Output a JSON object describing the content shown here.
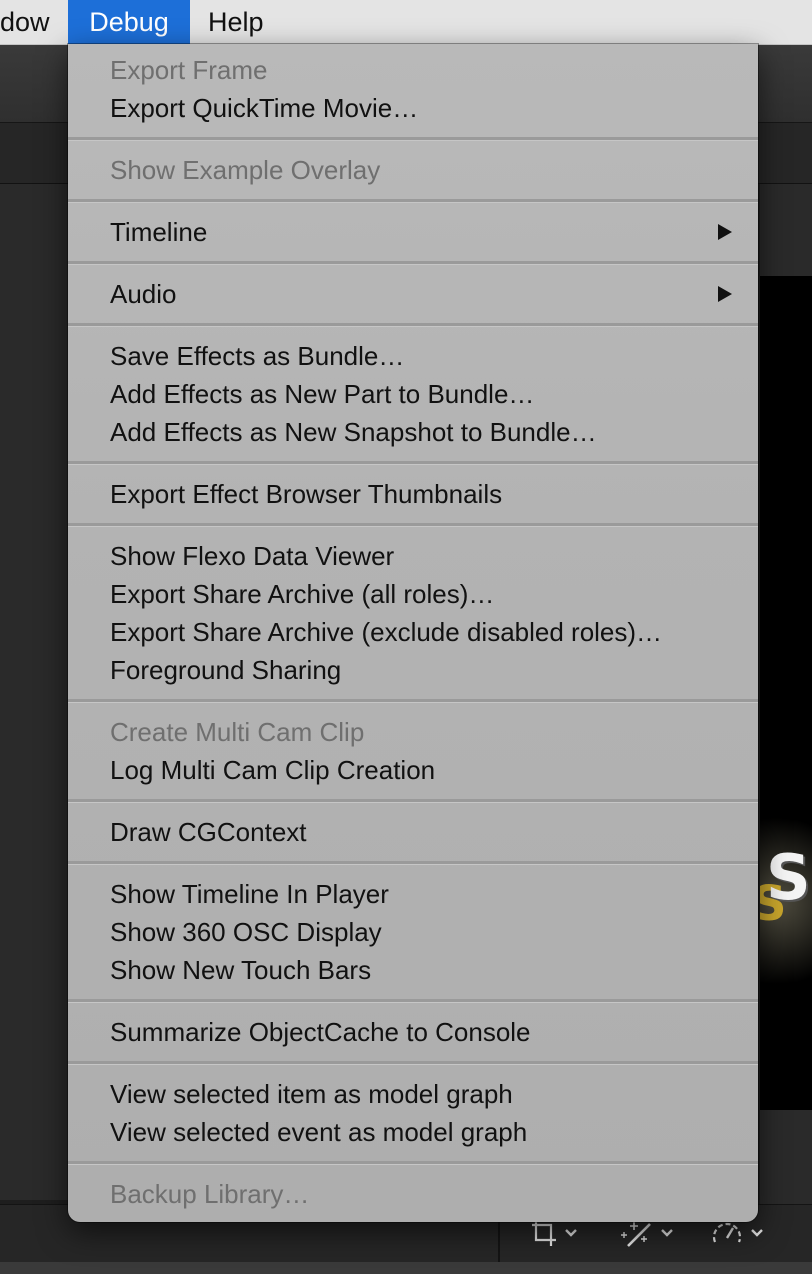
{
  "menubar": {
    "items": [
      {
        "label": "dow",
        "active": false
      },
      {
        "label": "Debug",
        "active": true
      },
      {
        "label": "Help",
        "active": false
      }
    ]
  },
  "menu": {
    "items": [
      {
        "label": "Export Frame",
        "enabled": false
      },
      {
        "label": "Export QuickTime Movie…",
        "enabled": true
      },
      {
        "label": "Show Example Overlay",
        "enabled": false
      },
      {
        "label": "Timeline",
        "enabled": true,
        "submenu": true
      },
      {
        "label": "Audio",
        "enabled": true,
        "submenu": true
      },
      {
        "label": "Save Effects as Bundle…",
        "enabled": true
      },
      {
        "label": "Add Effects as New Part to Bundle…",
        "enabled": true
      },
      {
        "label": "Add Effects as New Snapshot to Bundle…",
        "enabled": true
      },
      {
        "label": "Export Effect Browser Thumbnails",
        "enabled": true
      },
      {
        "label": "Show Flexo Data Viewer",
        "enabled": true
      },
      {
        "label": "Export Share Archive (all roles)…",
        "enabled": true
      },
      {
        "label": "Export Share Archive (exclude disabled roles)…",
        "enabled": true
      },
      {
        "label": "Foreground Sharing",
        "enabled": true
      },
      {
        "label": "Create Multi Cam Clip",
        "enabled": false
      },
      {
        "label": "Log Multi Cam Clip Creation",
        "enabled": true
      },
      {
        "label": "Draw CGContext",
        "enabled": true
      },
      {
        "label": "Show Timeline In Player",
        "enabled": true
      },
      {
        "label": "Show 360 OSC Display",
        "enabled": true
      },
      {
        "label": "Show New Touch Bars",
        "enabled": true
      },
      {
        "label": "Summarize ObjectCache to Console",
        "enabled": true
      },
      {
        "label": "View selected item as model graph",
        "enabled": true
      },
      {
        "label": "View selected event as model graph",
        "enabled": true
      },
      {
        "label": "Backup Library…",
        "enabled": false
      }
    ]
  },
  "background": {
    "viewer_title_glyph": "S",
    "bottom_controls": [
      "crop-icon",
      "enhance-wand-icon",
      "speed-gauge-icon"
    ]
  },
  "colors": {
    "menubar_bg": "#e4e4e4",
    "active_highlight": "#1d6fd8",
    "menu_bg": "#b5b5b5",
    "disabled_text": "#6f6f6f",
    "enabled_text": "#111111"
  }
}
